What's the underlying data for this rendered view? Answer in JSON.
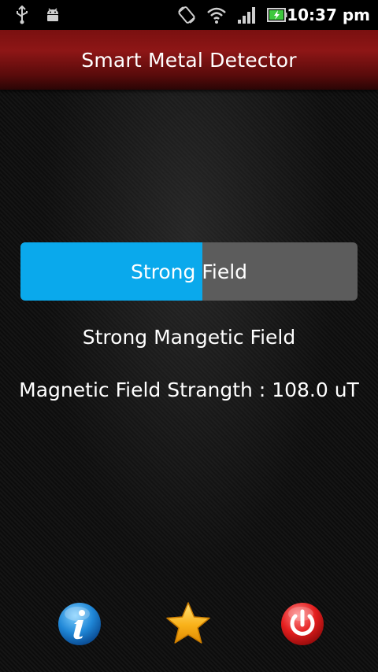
{
  "status_bar": {
    "time": "10:37 pm",
    "icons": [
      "usb-icon",
      "android-debug-icon",
      "auto-rotate-icon",
      "wifi-icon",
      "signal-icon",
      "battery-charging-icon"
    ]
  },
  "app": {
    "title": "Smart Metal Detector"
  },
  "field_meter": {
    "label": "Strong Field",
    "level_percent": 54,
    "fill_color": "#0aa9ec",
    "track_color": "#5c5c5c"
  },
  "readout": {
    "status": "Strong Mangetic Field",
    "strength": "Magnetic Field Strangth : 108.0 uT"
  },
  "toolbar": {
    "buttons": [
      "info-icon",
      "star-icon",
      "power-icon"
    ]
  },
  "colors": {
    "title_bar": "#8e1616",
    "accent": "#0aa9ec"
  }
}
